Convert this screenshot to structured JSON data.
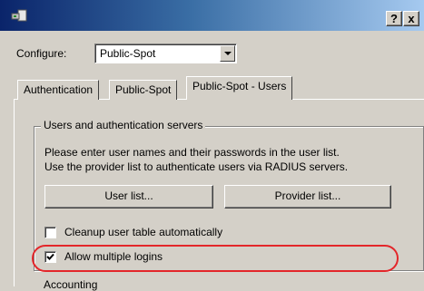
{
  "titlebar": {
    "help_label": "?",
    "close_label": "x"
  },
  "configure": {
    "label": "Configure:",
    "value": "Public-Spot"
  },
  "tabs": [
    {
      "label": "Authentication",
      "active": false
    },
    {
      "label": "Public-Spot",
      "active": false
    },
    {
      "label": "Public-Spot - Users",
      "active": true
    }
  ],
  "group": {
    "title": "Users and authentication servers",
    "description_line1": "Please enter user names and their passwords in the user list.",
    "description_line2": "Use the provider list to authenticate users via RADIUS servers.",
    "user_list_button": "User list...",
    "provider_list_button": "Provider list...",
    "cleanup_label": "Cleanup user table automatically",
    "cleanup_checked": false,
    "multiple_logins_label": "Allow multiple logins",
    "multiple_logins_checked": true
  },
  "next_group": {
    "title": "Accounting"
  },
  "colors": {
    "highlight": "#e3262a",
    "title_gradient_start": "#0a246a",
    "title_gradient_end": "#a6caf0"
  }
}
